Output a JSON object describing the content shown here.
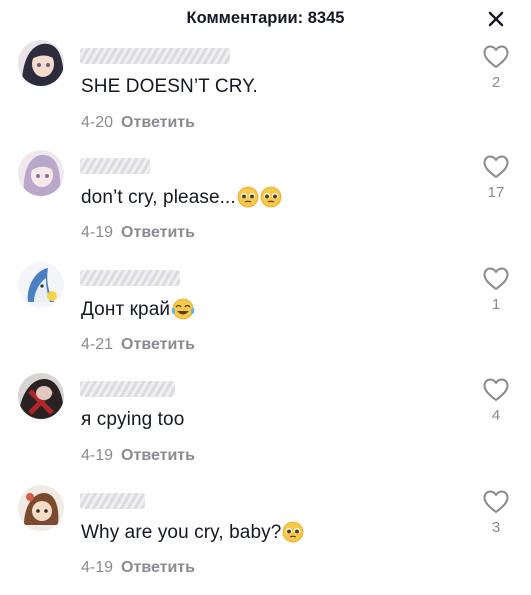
{
  "header": {
    "title": "Комментарии: 8345",
    "close_icon": "close-icon"
  },
  "comments": [
    {
      "text": "SHE DOESN’T CRY.",
      "emojis": [],
      "date": "4-20",
      "reply_label": "Ответить",
      "likes": "2"
    },
    {
      "text": "don’t cry, please...",
      "emojis": [
        "pleading-face",
        "pleading-face"
      ],
      "date": "4-19",
      "reply_label": "Ответить",
      "likes": "17"
    },
    {
      "text": "Донт край",
      "emojis": [
        "tears-of-joy-face"
      ],
      "date": "4-21",
      "reply_label": "Ответить",
      "likes": "1"
    },
    {
      "text": "я cpying too",
      "emojis": [],
      "date": "4-19",
      "reply_label": "Ответить",
      "likes": "4"
    },
    {
      "text": "Why are you cry, baby?",
      "emojis": [
        "pleading-face"
      ],
      "date": "4-19",
      "reply_label": "Ответить",
      "likes": "3"
    }
  ],
  "colors": {
    "text": "#161823",
    "secondary": "#8a8b91",
    "background": "#ffffff"
  }
}
